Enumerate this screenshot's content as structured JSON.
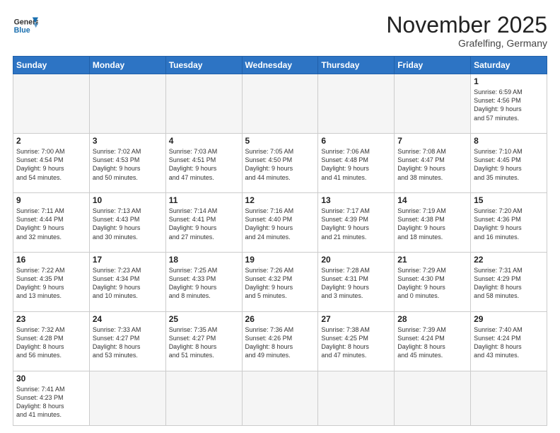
{
  "header": {
    "logo_general": "General",
    "logo_blue": "Blue",
    "month_title": "November 2025",
    "location": "Grafelfing, Germany"
  },
  "weekdays": [
    "Sunday",
    "Monday",
    "Tuesday",
    "Wednesday",
    "Thursday",
    "Friday",
    "Saturday"
  ],
  "weeks": [
    [
      {
        "day": "",
        "info": "",
        "empty": true
      },
      {
        "day": "",
        "info": "",
        "empty": true
      },
      {
        "day": "",
        "info": "",
        "empty": true
      },
      {
        "day": "",
        "info": "",
        "empty": true
      },
      {
        "day": "",
        "info": "",
        "empty": true
      },
      {
        "day": "",
        "info": "",
        "empty": true
      },
      {
        "day": "1",
        "info": "Sunrise: 6:59 AM\nSunset: 4:56 PM\nDaylight: 9 hours\nand 57 minutes."
      }
    ],
    [
      {
        "day": "2",
        "info": "Sunrise: 7:00 AM\nSunset: 4:54 PM\nDaylight: 9 hours\nand 54 minutes."
      },
      {
        "day": "3",
        "info": "Sunrise: 7:02 AM\nSunset: 4:53 PM\nDaylight: 9 hours\nand 50 minutes."
      },
      {
        "day": "4",
        "info": "Sunrise: 7:03 AM\nSunset: 4:51 PM\nDaylight: 9 hours\nand 47 minutes."
      },
      {
        "day": "5",
        "info": "Sunrise: 7:05 AM\nSunset: 4:50 PM\nDaylight: 9 hours\nand 44 minutes."
      },
      {
        "day": "6",
        "info": "Sunrise: 7:06 AM\nSunset: 4:48 PM\nDaylight: 9 hours\nand 41 minutes."
      },
      {
        "day": "7",
        "info": "Sunrise: 7:08 AM\nSunset: 4:47 PM\nDaylight: 9 hours\nand 38 minutes."
      },
      {
        "day": "8",
        "info": "Sunrise: 7:10 AM\nSunset: 4:45 PM\nDaylight: 9 hours\nand 35 minutes."
      }
    ],
    [
      {
        "day": "9",
        "info": "Sunrise: 7:11 AM\nSunset: 4:44 PM\nDaylight: 9 hours\nand 32 minutes."
      },
      {
        "day": "10",
        "info": "Sunrise: 7:13 AM\nSunset: 4:43 PM\nDaylight: 9 hours\nand 30 minutes."
      },
      {
        "day": "11",
        "info": "Sunrise: 7:14 AM\nSunset: 4:41 PM\nDaylight: 9 hours\nand 27 minutes."
      },
      {
        "day": "12",
        "info": "Sunrise: 7:16 AM\nSunset: 4:40 PM\nDaylight: 9 hours\nand 24 minutes."
      },
      {
        "day": "13",
        "info": "Sunrise: 7:17 AM\nSunset: 4:39 PM\nDaylight: 9 hours\nand 21 minutes."
      },
      {
        "day": "14",
        "info": "Sunrise: 7:19 AM\nSunset: 4:38 PM\nDaylight: 9 hours\nand 18 minutes."
      },
      {
        "day": "15",
        "info": "Sunrise: 7:20 AM\nSunset: 4:36 PM\nDaylight: 9 hours\nand 16 minutes."
      }
    ],
    [
      {
        "day": "16",
        "info": "Sunrise: 7:22 AM\nSunset: 4:35 PM\nDaylight: 9 hours\nand 13 minutes."
      },
      {
        "day": "17",
        "info": "Sunrise: 7:23 AM\nSunset: 4:34 PM\nDaylight: 9 hours\nand 10 minutes."
      },
      {
        "day": "18",
        "info": "Sunrise: 7:25 AM\nSunset: 4:33 PM\nDaylight: 9 hours\nand 8 minutes."
      },
      {
        "day": "19",
        "info": "Sunrise: 7:26 AM\nSunset: 4:32 PM\nDaylight: 9 hours\nand 5 minutes."
      },
      {
        "day": "20",
        "info": "Sunrise: 7:28 AM\nSunset: 4:31 PM\nDaylight: 9 hours\nand 3 minutes."
      },
      {
        "day": "21",
        "info": "Sunrise: 7:29 AM\nSunset: 4:30 PM\nDaylight: 9 hours\nand 0 minutes."
      },
      {
        "day": "22",
        "info": "Sunrise: 7:31 AM\nSunset: 4:29 PM\nDaylight: 8 hours\nand 58 minutes."
      }
    ],
    [
      {
        "day": "23",
        "info": "Sunrise: 7:32 AM\nSunset: 4:28 PM\nDaylight: 8 hours\nand 56 minutes."
      },
      {
        "day": "24",
        "info": "Sunrise: 7:33 AM\nSunset: 4:27 PM\nDaylight: 8 hours\nand 53 minutes."
      },
      {
        "day": "25",
        "info": "Sunrise: 7:35 AM\nSunset: 4:27 PM\nDaylight: 8 hours\nand 51 minutes."
      },
      {
        "day": "26",
        "info": "Sunrise: 7:36 AM\nSunset: 4:26 PM\nDaylight: 8 hours\nand 49 minutes."
      },
      {
        "day": "27",
        "info": "Sunrise: 7:38 AM\nSunset: 4:25 PM\nDaylight: 8 hours\nand 47 minutes."
      },
      {
        "day": "28",
        "info": "Sunrise: 7:39 AM\nSunset: 4:24 PM\nDaylight: 8 hours\nand 45 minutes."
      },
      {
        "day": "29",
        "info": "Sunrise: 7:40 AM\nSunset: 4:24 PM\nDaylight: 8 hours\nand 43 minutes."
      }
    ],
    [
      {
        "day": "30",
        "info": "Sunrise: 7:41 AM\nSunset: 4:23 PM\nDaylight: 8 hours\nand 41 minutes."
      },
      {
        "day": "",
        "info": "",
        "empty": true
      },
      {
        "day": "",
        "info": "",
        "empty": true
      },
      {
        "day": "",
        "info": "",
        "empty": true
      },
      {
        "day": "",
        "info": "",
        "empty": true
      },
      {
        "day": "",
        "info": "",
        "empty": true
      },
      {
        "day": "",
        "info": "",
        "empty": true
      }
    ]
  ]
}
